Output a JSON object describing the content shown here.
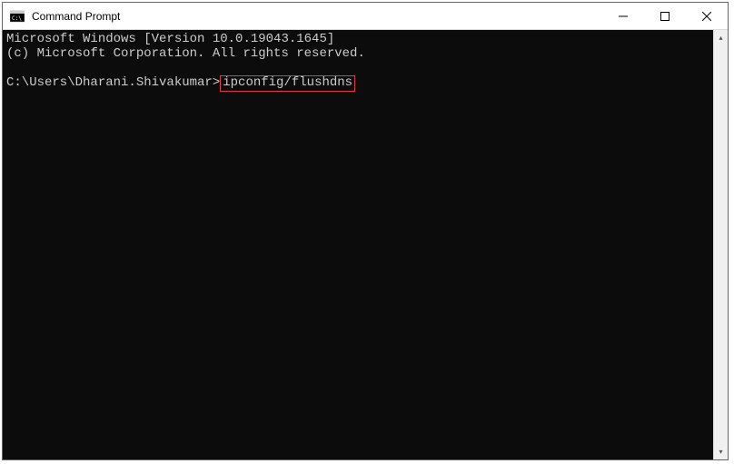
{
  "window": {
    "title": "Command Prompt"
  },
  "terminal": {
    "line1": "Microsoft Windows [Version 10.0.19043.1645]",
    "line2": "(c) Microsoft Corporation. All rights reserved.",
    "prompt": "C:\\Users\\Dharani.Shivakumar>",
    "command": "ipconfig/flushdns"
  },
  "scrollbar": {
    "up": "▴",
    "down": "▾"
  }
}
